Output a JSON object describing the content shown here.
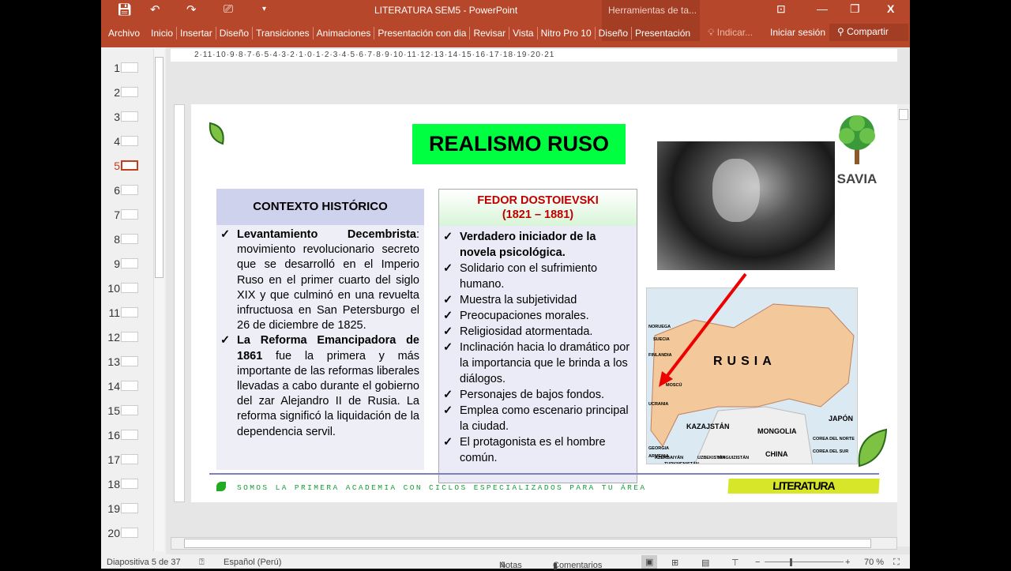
{
  "window": {
    "title": "LITERATURA SEM5 - PowerPoint",
    "context_tab": "Herramientas de ta...",
    "minimize": "—",
    "restore": "❐",
    "close": "X"
  },
  "ribbon": {
    "tabs": [
      "Archivo",
      "Inicio",
      "Insertar",
      "Diseño",
      "Transiciones",
      "Animaciones",
      "Presentación con dia",
      "Revisar",
      "Vista",
      "Nitro Pro 10",
      "Diseño",
      "Presentación"
    ],
    "tell_me": "Indicar...",
    "sign_in": "Iniciar sesión",
    "share": "Compartir"
  },
  "thumbnails": [
    "1",
    "2",
    "3",
    "4",
    "5",
    "6",
    "7",
    "8",
    "9",
    "10",
    "11",
    "12",
    "13",
    "14",
    "15",
    "16",
    "17",
    "18",
    "19",
    "20"
  ],
  "selected_slide": 5,
  "ruler": "2·11·10·9·8·7·6·5·4·3·2·1·0·1·2·3·4·5·6·7·8·9·10·11·12·13·14·15·16·17·18·19·20·21",
  "slide": {
    "title": "REALISMO RUSO",
    "context": {
      "heading": "CONTEXTO HISTÓRICO",
      "items": [
        {
          "bold": "Levantamiento Decembrista",
          "text": ": movimiento revolucionario secreto que se desarrolló en el Imperio Ruso en el primer cuarto del siglo XIX y que culminó en una revuelta infructuosa en San Petersburgo el 26 de diciembre de 1825."
        },
        {
          "bold": "La Reforma Emancipadora de 1861",
          "text": " fue la primera y más importante de las reformas liberales llevadas a cabo durante el gobierno del zar Alejandro II de Rusia. La reforma significó la liquidación de la dependencia servil."
        }
      ]
    },
    "author": {
      "name": "FEDOR DOSTOIEVSKI",
      "years": "(1821 – 1881)",
      "items": [
        "Verdadero iniciador de la novela psicológica.",
        "Solidario con el sufrimiento humano.",
        "Muestra la subjetividad",
        "Preocupaciones morales.",
        "Religiosidad atormentada.",
        "Inclinación hacia lo dramático por la importancia que le brinda a los diálogos.",
        "Personajes de bajos fondos.",
        "Emplea como escenario principal la ciudad.",
        "El protagonista es el hombre común."
      ]
    },
    "logo": "SAVIA",
    "map": {
      "country": "RUSIA",
      "labels": [
        "NORUEGA",
        "SUECIA",
        "FINLANDIA",
        "UCRANIA",
        "MOSCÚ",
        "KAZAJSTÁN",
        "MONGOLIA",
        "CHINA",
        "JAPÓN",
        "COREA DEL NORTE",
        "COREA DEL SUR",
        "GEORGIA",
        "ARMENIA",
        "AZERBAIYÁN",
        "UZBEKISTÁN",
        "TURKMENISTÁN",
        "KIRGUIZISTÁN"
      ]
    },
    "footer": "SOMOS LA PRIMERA ACADEMIA CON CICLOS ESPECIALIZADOS PARA TU ÁREA",
    "badge": "LITERATURA"
  },
  "status": {
    "slide": "Diapositiva 5 de 37",
    "language": "Español (Perú)",
    "notes": "Notas",
    "comments": "Comentarios",
    "zoom": "70 %"
  },
  "colors": {
    "accent": "#b7472a",
    "title_bg": "#00ff40",
    "author": "#c00000"
  }
}
